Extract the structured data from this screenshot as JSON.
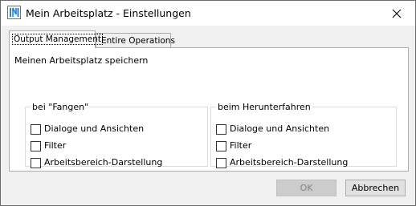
{
  "window": {
    "title": "Mein Arbeitsplatz - Einstellungen",
    "icon": "app-logo-icon",
    "close_icon": "close-icon"
  },
  "tabs": [
    {
      "label": "Output Management",
      "active": true
    },
    {
      "label": "Entire Operations",
      "active": false
    }
  ],
  "panel": {
    "heading": "Meinen Arbeitsplatz speichern",
    "groups": [
      {
        "legend": "bei \"Fangen\"",
        "options": [
          {
            "label": "Dialoge und Ansichten",
            "checked": false
          },
          {
            "label": "Filter",
            "checked": false
          },
          {
            "label": "Arbeitsbereich-Darstellung",
            "checked": false
          }
        ]
      },
      {
        "legend": "beim Herunterfahren",
        "options": [
          {
            "label": "Dialoge und Ansichten",
            "checked": false
          },
          {
            "label": "Filter",
            "checked": false
          },
          {
            "label": "Arbeitsbereich-Darstellung",
            "checked": false
          }
        ]
      }
    ]
  },
  "buttons": {
    "ok_label": "OK",
    "ok_enabled": false,
    "cancel_label": "Abbrechen"
  },
  "colors": {
    "accent": "#1e90ff",
    "disabled_text": "#838383"
  }
}
